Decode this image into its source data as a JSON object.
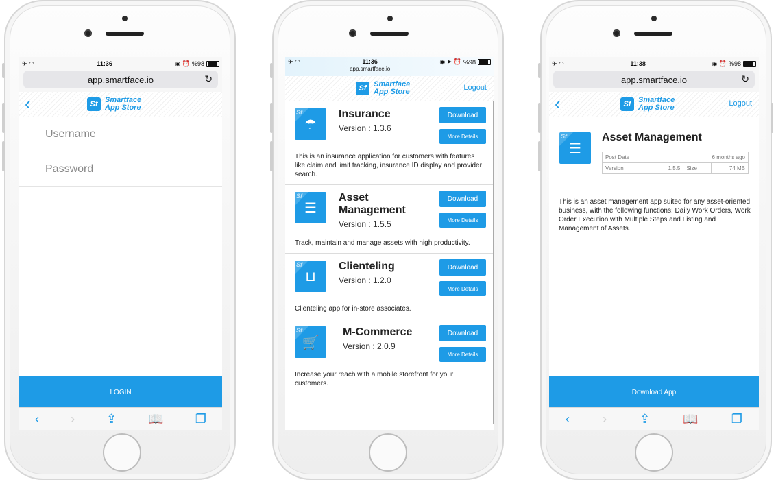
{
  "colors": {
    "accent": "#1e9be6",
    "text": "#222222",
    "muted": "#888888"
  },
  "phones": {
    "login": {
      "status": {
        "time": "11:36",
        "battery": "%98"
      },
      "url": "app.smartface.io",
      "logo_text": "Smartface App Store",
      "username_placeholder": "Username",
      "password_placeholder": "Password",
      "login_label": "LOGIN"
    },
    "list": {
      "status": {
        "time": "11:36",
        "battery": "%98"
      },
      "url": "app.smartface.io",
      "logo_text": "Smartface App Store",
      "logout_label": "Logout",
      "download_label": "Download",
      "more_label": "More Details",
      "apps": [
        {
          "name": "Insurance",
          "version": "Version : 1.3.6",
          "icon": "umbrella-hand-icon",
          "glyph": "☂",
          "description": "This is an insurance application for customers with features like claim and limit tracking, insurance ID display and provider search."
        },
        {
          "name": "Asset Management",
          "version": "Version : 1.5.5",
          "icon": "list-icon",
          "glyph": "☰",
          "description": "Track, maintain and manage assets with high productivity."
        },
        {
          "name": "Clienteling",
          "version": "Version : 1.2.0",
          "icon": "shopping-bag-icon",
          "glyph": "⊔",
          "description": "Clienteling app for in-store associates."
        },
        {
          "name": "M-Commerce",
          "version": "Version : 2.0.9",
          "icon": "cart-icon",
          "glyph": "🛒",
          "description": "Increase your reach with a mobile storefront for your customers."
        }
      ]
    },
    "detail": {
      "status": {
        "time": "11:38",
        "battery": "%98"
      },
      "url": "app.smartface.io",
      "logo_text": "Smartface App Store",
      "logout_label": "Logout",
      "title": "Asset Management",
      "post_date_label": "Post Date",
      "post_date_value": "6 months ago",
      "version_label": "Version",
      "version_value": "1.5.5",
      "size_label": "Size",
      "size_value": "74 MB",
      "description": "This is an asset management app suited for any asset-oriented business, with the following functions: Daily Work Orders, Work Order Execution with Multiple Steps and Listing and Management of Assets.",
      "download_app_label": "Download App"
    }
  }
}
